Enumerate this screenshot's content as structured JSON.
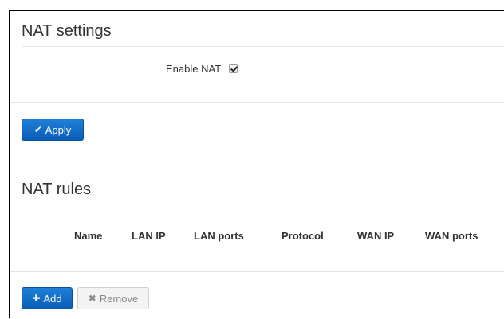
{
  "nat_settings": {
    "title": "NAT settings",
    "enable_label": "Enable NAT",
    "enabled": true,
    "apply_label": "Apply",
    "apply_icon": "checkmark-icon"
  },
  "nat_rules": {
    "title": "NAT rules",
    "columns": [
      "Name",
      "LAN IP",
      "LAN ports",
      "Protocol",
      "WAN IP",
      "WAN ports"
    ],
    "rows": [],
    "add_label": "Add",
    "add_icon": "plus-icon",
    "remove_label": "Remove",
    "remove_icon": "x-icon"
  },
  "colors": {
    "primary": "#0a5db8",
    "text": "#333333",
    "divider": "#e5e5e5"
  }
}
